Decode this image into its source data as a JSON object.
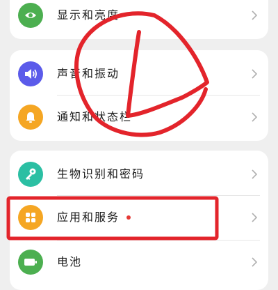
{
  "settings": {
    "items": [
      {
        "label": "显示和亮度",
        "icon": "eye-icon",
        "color": "#4caf50"
      },
      {
        "label": "声音和振动",
        "icon": "speaker-icon",
        "color": "#5b5bea"
      },
      {
        "label": "通知和状态栏",
        "icon": "bell-icon",
        "color": "#f5a623"
      },
      {
        "label": "生物识别和密码",
        "icon": "key-icon",
        "color": "#2bbfa3"
      },
      {
        "label": "应用和服务",
        "icon": "apps-icon",
        "color": "#f5a623"
      },
      {
        "label": "电池",
        "icon": "battery-icon",
        "color": "#4caf50"
      }
    ]
  },
  "colors": {
    "annotation_red": "#e3242b",
    "badge_dot": "#e53935"
  }
}
